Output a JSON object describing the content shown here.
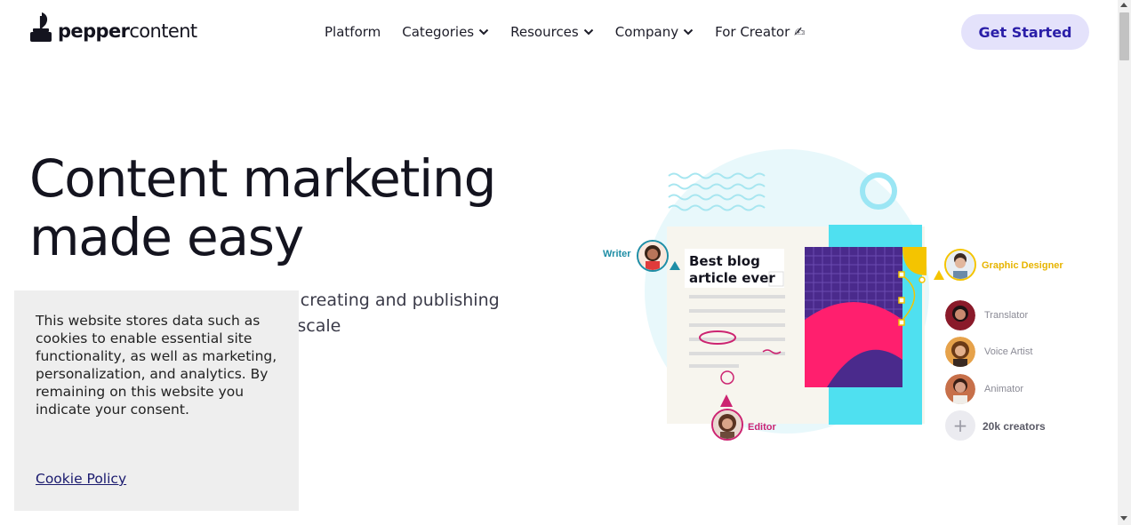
{
  "header": {
    "logo": {
      "bold": "pepper",
      "light": "content"
    },
    "nav": [
      {
        "label": "Platform",
        "dropdown": false
      },
      {
        "label": "Categories",
        "dropdown": true
      },
      {
        "label": "Resources",
        "dropdown": true
      },
      {
        "label": "Company",
        "dropdown": true
      },
      {
        "label": "For Creator ✍",
        "dropdown": false
      }
    ],
    "cta_label": "Get Started"
  },
  "hero": {
    "title_line1": "Content marketing",
    "title_line2": "made easy",
    "subtitle": "Unlock the power of content by creating and publishing content that drives growth and scale"
  },
  "cookie_banner": {
    "text": "This website stores data such as cookies to enable essential site functionality, as well as marketing, personalization, and analytics. By remaining on this website you indicate your consent.",
    "link_label": "Cookie Policy"
  },
  "illustration": {
    "card_title_line1": "Best blog",
    "card_title_line2": "article ever",
    "roles": {
      "writer": "Writer",
      "editor": "Editor",
      "graphic_designer": "Graphic Designer",
      "translator": "Translator",
      "voice_artist": "Voice Artist",
      "animator": "Animator",
      "creators": "20k creators"
    }
  },
  "colors": {
    "accent": "#2a1ea8",
    "cta_bg": "#e4e2fb",
    "teal": "#1f8ea6",
    "magenta": "#cc2471",
    "yellow": "#f4c400",
    "purple": "#4a2a8c",
    "cyan": "#4fe0f0",
    "pink": "#ff1f6e"
  }
}
